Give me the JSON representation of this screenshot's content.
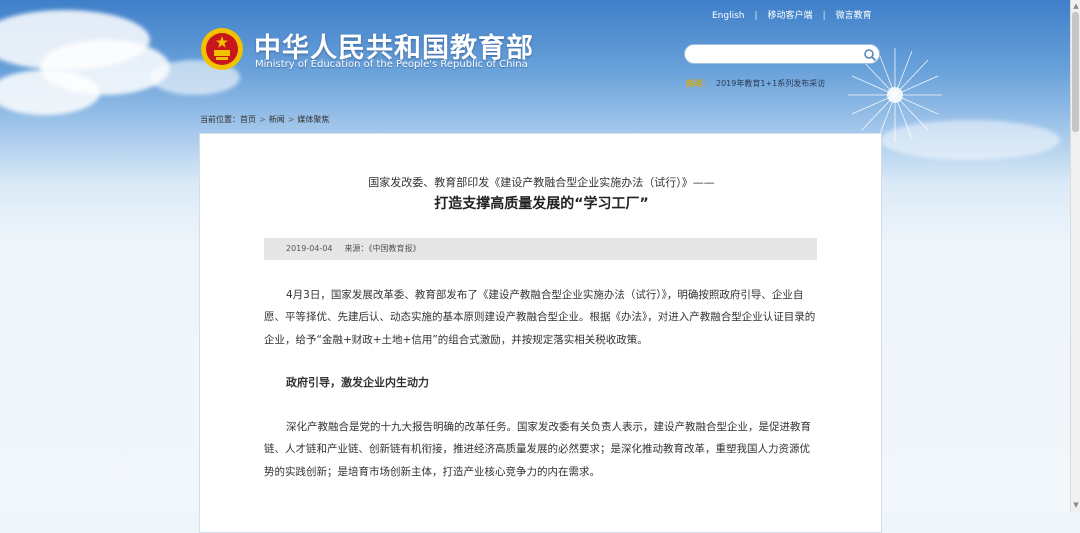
{
  "header": {
    "title_cn": "中华人民共和国教育部",
    "title_en": "Ministry of Education of the People's Republic of China",
    "top_links": [
      "English",
      "移动客户端",
      "微言教育"
    ],
    "search": {
      "placeholder": ""
    },
    "hot_label": "热词：",
    "hot_text": "2019年教育1+1系列发布采访"
  },
  "breadcrumb": {
    "prefix": "当前位置：",
    "items": [
      "首页",
      "新闻",
      "媒体聚焦"
    ]
  },
  "article": {
    "title_line1": "国家发改委、教育部印发《建设产教融合型企业实施办法（试行）》——",
    "title_line2": "打造支撑高质量发展的“学习工厂”",
    "date": "2019-04-04",
    "source": "来源：《中国教育报》",
    "para1": "4月3日，国家发展改革委、教育部发布了《建设产教融合型企业实施办法（试行）》，明确按照政府引导、企业自愿、平等择优、先建后认、动态实施的基本原则建设产教融合型企业。根据《办法》，对进入产教融合型企业认证目录的企业，给予“金融+财政+土地+信用”的组合式激励，并按规定落实相关税收政策。",
    "subheading": "政府引导，激发企业内生动力",
    "para2": "深化产教融合是党的十九大报告明确的改革任务。国家发改委有关负责人表示，建设产教融合型企业，是促进教育链、人才链和产业链、创新链有机衔接，推进经济高质量发展的必然要求；是深化推动教育改革，重塑我国人力资源优势的实践创新；是培育市场创新主体，打造产业核心竞争力的内在需求。"
  },
  "colors": {
    "sky_top": "#3f7fc9",
    "hot_label": "#e0a800",
    "emblem_red": "#c8161d",
    "emblem_gold": "#f2c200"
  },
  "icons": {
    "emblem": "national-emblem-icon",
    "search": "search-icon",
    "dandelion": "dandelion-decoration"
  }
}
